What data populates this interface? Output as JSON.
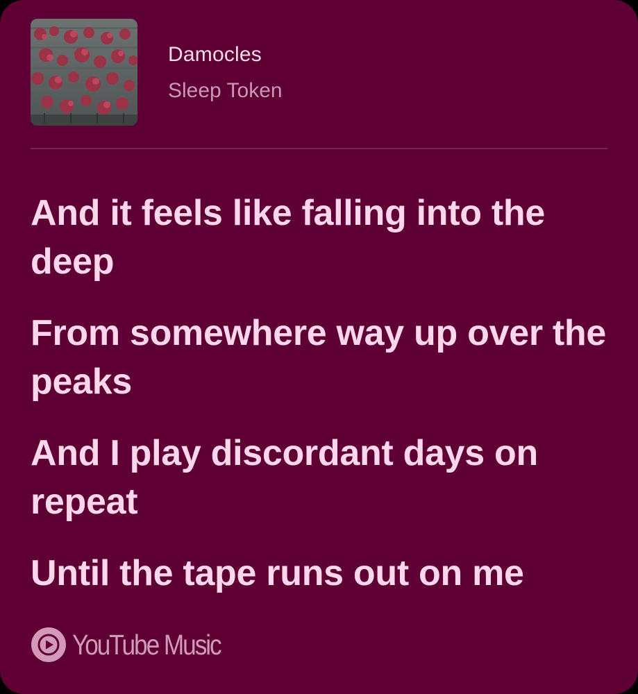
{
  "colors": {
    "card_background": "#5f0035",
    "lyric_text": "#fcd6ea",
    "title_text": "#f7dbea",
    "artist_text": "#c998b4",
    "divider": "#7b2352",
    "brand": "#d29ab8"
  },
  "track": {
    "title": "Damocles",
    "artist": "Sleep Token",
    "album_art_icon": "album-art"
  },
  "lyrics": {
    "lines": [
      "And it feels like falling into the deep",
      "From somewhere way up over the peaks",
      "And I play discordant days on repeat",
      "Until the tape runs out on me"
    ]
  },
  "footer": {
    "brand_icon": "youtube-music-logo-icon",
    "brand_name": "YouTube Music"
  }
}
